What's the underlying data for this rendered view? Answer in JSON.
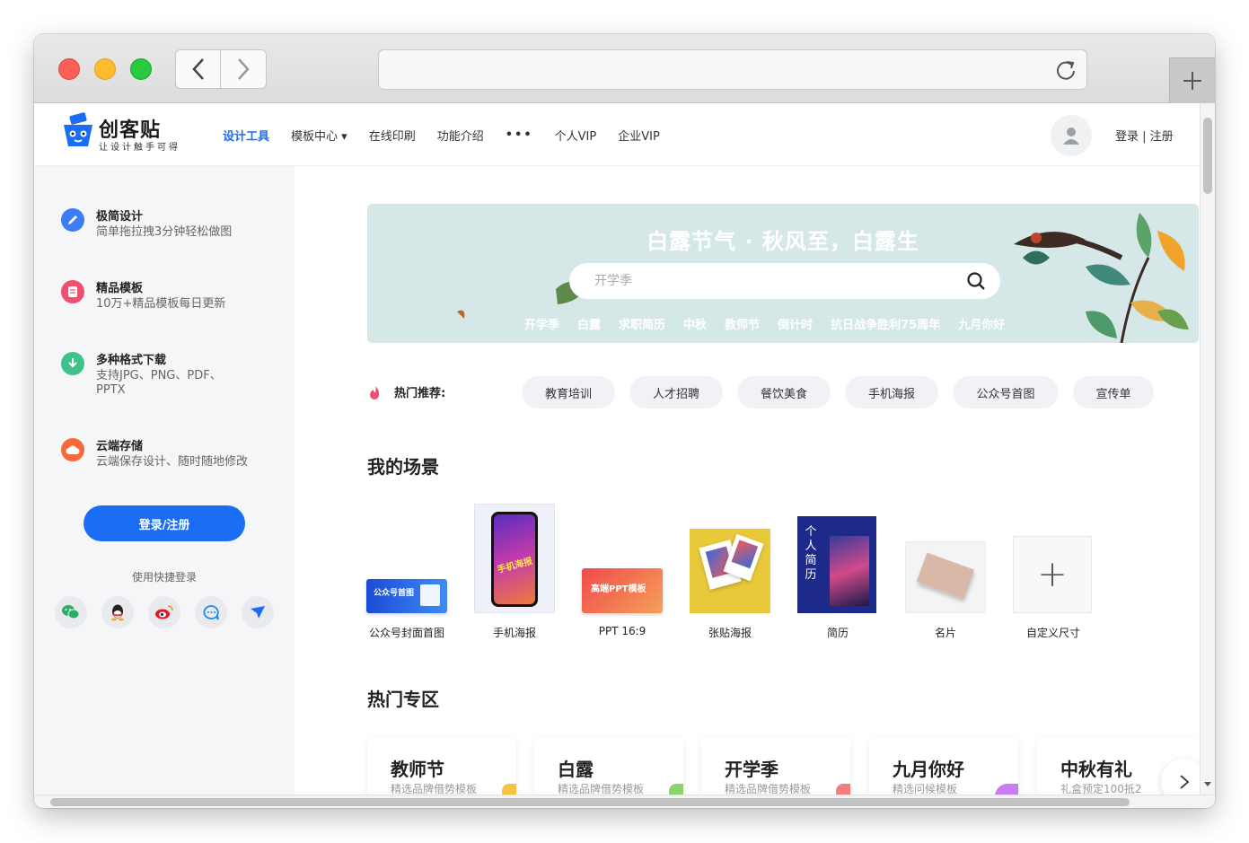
{
  "browser": {
    "url": "",
    "new_tab_label": "+"
  },
  "header": {
    "logo_title": "创客贴",
    "logo_subtitle": "让设计触手可得",
    "nav": [
      {
        "label": "设计工具",
        "active": true
      },
      {
        "label": "模板中心 ▾",
        "active": false
      },
      {
        "label": "在线印刷",
        "active": false
      },
      {
        "label": "功能介绍",
        "active": false
      },
      {
        "label": "•••",
        "active": false
      },
      {
        "label": "个人VIP",
        "active": false
      },
      {
        "label": "企业VIP",
        "active": false
      }
    ],
    "auth_label": "登录 | 注册"
  },
  "sidebar": {
    "features": [
      {
        "title": "极简设计",
        "desc": "简单拖拉拽3分钟轻松做图",
        "icon": "pencil-icon",
        "color": "#3d7cf5"
      },
      {
        "title": "精品模板",
        "desc": "10万+精品模板每日更新",
        "icon": "template-icon",
        "color": "#f0506e"
      },
      {
        "title": "多种格式下载",
        "desc": "支持JPG、PNG、PDF、PPTX",
        "icon": "download-icon",
        "color": "#3fc28a"
      },
      {
        "title": "云端存储",
        "desc": "云端保存设计、随时随地修改",
        "icon": "cloud-icon",
        "color": "#f5693a"
      }
    ],
    "login_button": "登录/注册",
    "quick_login_label": "使用快捷登录",
    "social": [
      "wechat-icon",
      "qq-icon",
      "weibo-icon",
      "dingtalk-icon",
      "feishu-icon"
    ]
  },
  "banner": {
    "title": "白露节气 · 秋风至，白露生",
    "search_placeholder": "开学季",
    "tags": [
      "开学季",
      "白露",
      "求职简历",
      "中秋",
      "教师节",
      "倒计时",
      "抗日战争胜利75周年",
      "九月你好"
    ]
  },
  "hot": {
    "label": "热门推荐:",
    "chips": [
      "教育培训",
      "人才招聘",
      "餐饮美食",
      "手机海报",
      "公众号首图",
      "宣传单"
    ]
  },
  "scenes": {
    "title": "我的场景",
    "items": [
      {
        "label": "公众号封面首图",
        "thumb_text": "公众号首图"
      },
      {
        "label": "手机海报",
        "thumb_text": "手机海报"
      },
      {
        "label": "PPT 16:9",
        "thumb_text": "高端PPT模板"
      },
      {
        "label": "张贴海报",
        "thumb_text": ""
      },
      {
        "label": "简历",
        "thumb_text": "个人简历"
      },
      {
        "label": "名片",
        "thumb_text": ""
      },
      {
        "label": "自定义尺寸",
        "thumb_text": "+"
      }
    ]
  },
  "zone": {
    "title": "热门专区",
    "cards": [
      {
        "title": "教师节",
        "sub": "精选品牌借势模板",
        "accent": "#f5c542"
      },
      {
        "title": "白露",
        "sub": "精选品牌借势模板",
        "accent": "#8fd16a"
      },
      {
        "title": "开学季",
        "sub": "精选品牌借势模板",
        "accent": "#f27f7f"
      },
      {
        "title": "九月你好",
        "sub": "精选问候模板",
        "accent": "#c77ef0"
      },
      {
        "title": "中秋有礼",
        "sub": "礼盒预定100抵2",
        "accent": "#f0a35e"
      }
    ]
  }
}
